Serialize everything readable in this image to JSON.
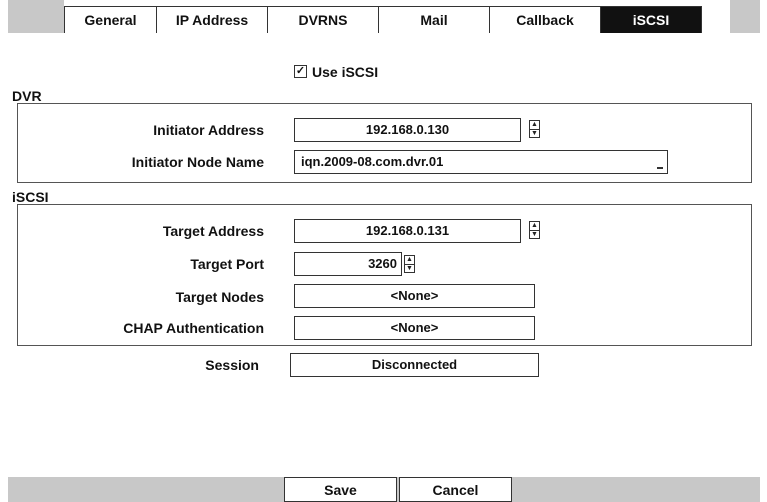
{
  "tabs": [
    {
      "label": "General",
      "active": false
    },
    {
      "label": "IP Address",
      "active": false
    },
    {
      "label": "DVRNS",
      "active": false
    },
    {
      "label": "Mail",
      "active": false
    },
    {
      "label": "Callback",
      "active": false
    },
    {
      "label": "iSCSI",
      "active": true
    }
  ],
  "use_iscsi": {
    "label": "Use iSCSI",
    "checked": true
  },
  "dvr": {
    "title": "DVR",
    "initiator_address_label": "Initiator Address",
    "initiator_address_value": "192.168.0.130",
    "initiator_node_name_label": "Initiator Node Name",
    "initiator_node_name_value": "iqn.2009-08.com.dvr.01"
  },
  "iscsi": {
    "title": "iSCSI",
    "target_address_label": "Target Address",
    "target_address_value": "192.168.0.131",
    "target_port_label": "Target Port",
    "target_port_value": "3260",
    "target_nodes_label": "Target Nodes",
    "target_nodes_value": "<None>",
    "chap_label": "CHAP Authentication",
    "chap_value": "<None>"
  },
  "session": {
    "label": "Session",
    "value": "Disconnected"
  },
  "footer": {
    "save_label": "Save",
    "cancel_label": "Cancel"
  },
  "icons": {
    "checkbox": "checkmark-icon",
    "spin": "spin-arrows-icon"
  }
}
